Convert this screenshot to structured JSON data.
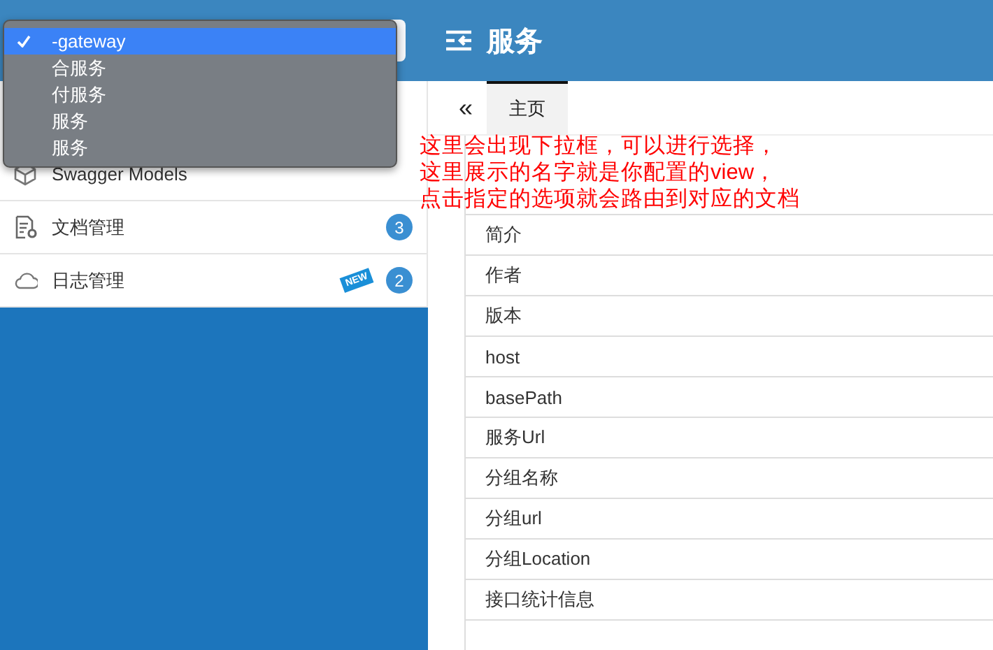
{
  "header": {
    "title": "服务"
  },
  "service_select": {
    "options": [
      {
        "label": "-gateway",
        "selected": true
      },
      {
        "label": "合服务",
        "selected": false
      },
      {
        "label": "付服务",
        "selected": false
      },
      {
        "label": "服务",
        "selected": false
      },
      {
        "label": "服务",
        "selected": false
      }
    ]
  },
  "sidebar": {
    "items": [
      {
        "label": "Swagger Models"
      },
      {
        "label": "文档管理",
        "badge": "3"
      },
      {
        "label": "日志管理",
        "badge": "2",
        "new_tag": "NEW"
      }
    ]
  },
  "tabs": {
    "collapse": "«",
    "items": [
      {
        "label": "主页",
        "selected": true
      }
    ]
  },
  "annotation": [
    "这里会出现下拉框，可以进行选择，",
    "这里展示的名字就是你配置的view，",
    "点击指定的选项就会路由到对应的文档"
  ],
  "info_rows": [
    "简介",
    "作者",
    "版本",
    "host",
    "basePath",
    "服务Url",
    "分组名称",
    "分组url",
    "分组Location",
    "接口统计信息"
  ]
}
